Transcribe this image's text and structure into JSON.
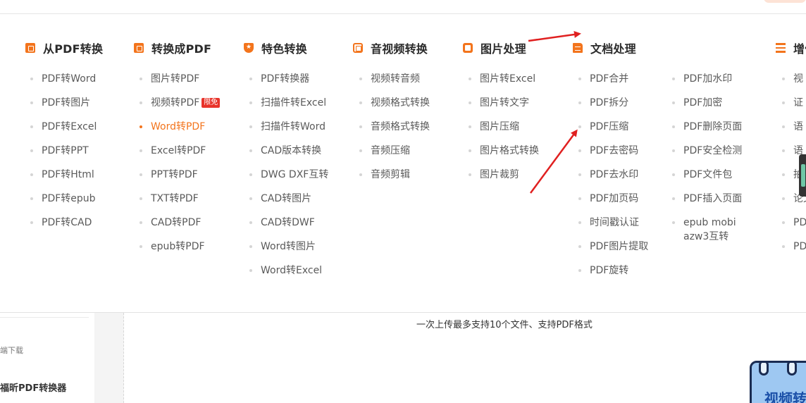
{
  "categories": [
    {
      "title": "从PDF转换",
      "icon": "pdf-document-icon",
      "items": [
        "PDF转Word",
        "PDF转图片",
        "PDF转Excel",
        "PDF转PPT",
        "PDF转Html",
        "PDF转epub",
        "PDF转CAD"
      ]
    },
    {
      "title": "转换成PDF",
      "icon": "to-pdf-document-icon",
      "items": [
        "图片转PDF",
        "视频转PDF",
        "Word转PDF",
        "Excel转PDF",
        "PPT转PDF",
        "TXT转PDF",
        "CAD转PDF",
        "epub转PDF"
      ],
      "badge": "限免",
      "active_item": "Word转PDF"
    },
    {
      "title": "特色转换",
      "icon": "star-shield-icon",
      "items": [
        "PDF转换器",
        "扫描件转Excel",
        "扫描件转Word",
        "CAD版本转换",
        "DWG DXF互转",
        "CAD转图片",
        "CAD转DWF",
        "Word转图片",
        "Word转Excel"
      ]
    },
    {
      "title": "音视频转换",
      "icon": "media-icon",
      "items": [
        "视频转音频",
        "视频格式转换",
        "音频格式转换",
        "音频压缩",
        "音频剪辑"
      ]
    },
    {
      "title": "图片处理",
      "icon": "image-icon",
      "items": [
        "图片转Excel",
        "图片转文字",
        "图片压缩",
        "图片格式转换",
        "图片裁剪"
      ]
    },
    {
      "title": "文档处理",
      "icon": "document-icon",
      "items": [
        "PDF合并",
        "PDF拆分",
        "PDF压缩",
        "PDF去密码",
        "PDF去水印",
        "PDF加页码",
        "时间戳认证",
        "PDF图片提取",
        "PDF旋转"
      ],
      "items_col2": [
        "PDF加水印",
        "PDF加密",
        "PDF删除页面",
        "PDF安全检测",
        "PDF文件包",
        "PDF插入页面",
        "epub mobi",
        "azw3互转"
      ]
    },
    {
      "title": "增值",
      "icon": "list-icon",
      "items": [
        "视",
        "证",
        "语",
        "语",
        "拍",
        "论文",
        "PD",
        "PD"
      ]
    }
  ],
  "left_panel": {
    "download": "端下载",
    "product": "福昕PDF转换器"
  },
  "upload_hint": "一次上传最多支持10个文件、支持PDF格式",
  "promo": {
    "text": "视频转"
  },
  "colors": {
    "accent": "#f3741c",
    "badge": "#e8332a",
    "arrow": "#e02020"
  }
}
